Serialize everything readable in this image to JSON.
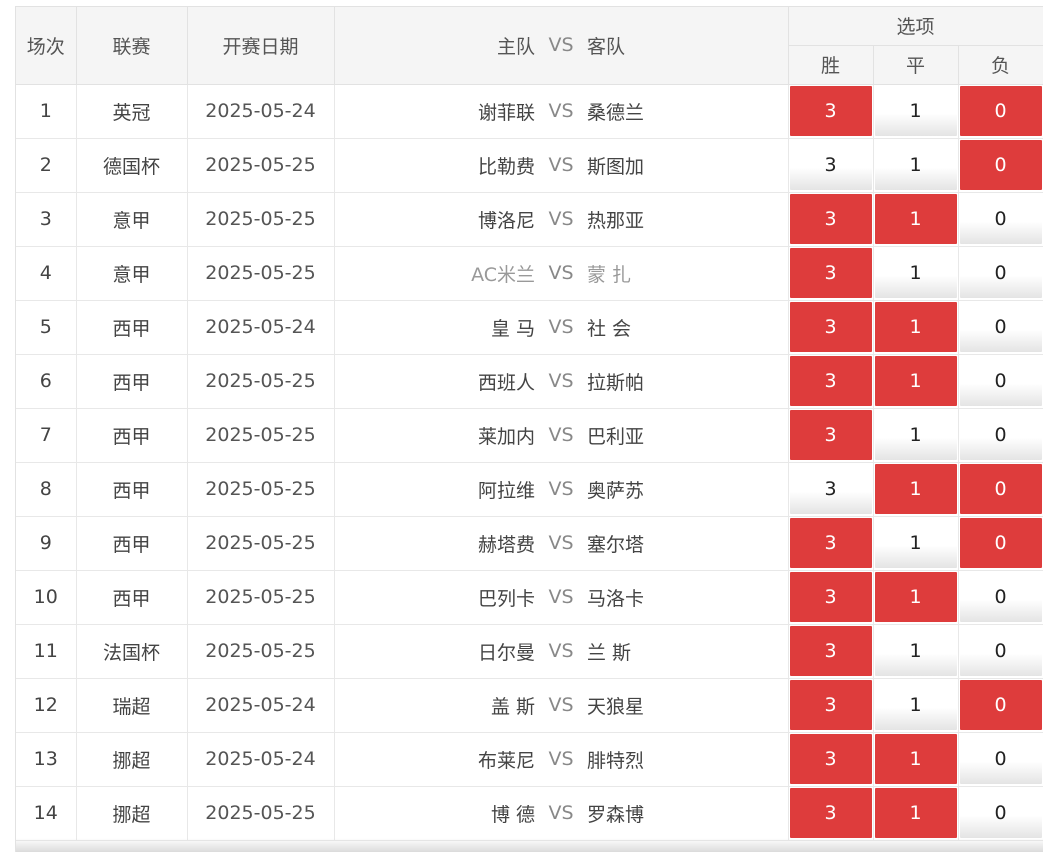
{
  "header": {
    "no": "场次",
    "league": "联赛",
    "date": "开赛日期",
    "home": "主队",
    "vs": "VS",
    "away": "客队",
    "options": "选项",
    "win": "胜",
    "draw": "平",
    "loss": "负"
  },
  "colors": {
    "selected": "#de3c3c",
    "unselected": "#f2f2f2"
  },
  "rows": [
    {
      "no": "1",
      "league": "英冠",
      "date": "2025-05-24",
      "home": "谢菲联",
      "vs": "VS",
      "away": "桑德兰",
      "win": "3",
      "draw": "1",
      "loss": "0",
      "sel": {
        "win": true,
        "draw": false,
        "loss": true
      }
    },
    {
      "no": "2",
      "league": "德国杯",
      "date": "2025-05-25",
      "home": "比勒费",
      "vs": "VS",
      "away": "斯图加",
      "win": "3",
      "draw": "1",
      "loss": "0",
      "sel": {
        "win": false,
        "draw": false,
        "loss": true
      }
    },
    {
      "no": "3",
      "league": "意甲",
      "date": "2025-05-25",
      "home": "博洛尼",
      "vs": "VS",
      "away": "热那亚",
      "win": "3",
      "draw": "1",
      "loss": "0",
      "sel": {
        "win": true,
        "draw": true,
        "loss": false
      }
    },
    {
      "no": "4",
      "league": "意甲",
      "date": "2025-05-25",
      "home": "AC米兰",
      "vs": "VS",
      "away": "蒙 扎",
      "win": "3",
      "draw": "1",
      "loss": "0",
      "sel": {
        "win": true,
        "draw": false,
        "loss": false
      },
      "muted": true
    },
    {
      "no": "5",
      "league": "西甲",
      "date": "2025-05-24",
      "home": "皇 马",
      "vs": "VS",
      "away": "社 会",
      "win": "3",
      "draw": "1",
      "loss": "0",
      "sel": {
        "win": true,
        "draw": true,
        "loss": false
      }
    },
    {
      "no": "6",
      "league": "西甲",
      "date": "2025-05-25",
      "home": "西班人",
      "vs": "VS",
      "away": "拉斯帕",
      "win": "3",
      "draw": "1",
      "loss": "0",
      "sel": {
        "win": true,
        "draw": true,
        "loss": false
      }
    },
    {
      "no": "7",
      "league": "西甲",
      "date": "2025-05-25",
      "home": "莱加内",
      "vs": "VS",
      "away": "巴利亚",
      "win": "3",
      "draw": "1",
      "loss": "0",
      "sel": {
        "win": true,
        "draw": false,
        "loss": false
      }
    },
    {
      "no": "8",
      "league": "西甲",
      "date": "2025-05-25",
      "home": "阿拉维",
      "vs": "VS",
      "away": "奥萨苏",
      "win": "3",
      "draw": "1",
      "loss": "0",
      "sel": {
        "win": false,
        "draw": true,
        "loss": true
      }
    },
    {
      "no": "9",
      "league": "西甲",
      "date": "2025-05-25",
      "home": "赫塔费",
      "vs": "VS",
      "away": "塞尔塔",
      "win": "3",
      "draw": "1",
      "loss": "0",
      "sel": {
        "win": true,
        "draw": false,
        "loss": true
      }
    },
    {
      "no": "10",
      "league": "西甲",
      "date": "2025-05-25",
      "home": "巴列卡",
      "vs": "VS",
      "away": "马洛卡",
      "win": "3",
      "draw": "1",
      "loss": "0",
      "sel": {
        "win": true,
        "draw": true,
        "loss": false
      }
    },
    {
      "no": "11",
      "league": "法国杯",
      "date": "2025-05-25",
      "home": "日尔曼",
      "vs": "VS",
      "away": "兰 斯",
      "win": "3",
      "draw": "1",
      "loss": "0",
      "sel": {
        "win": true,
        "draw": false,
        "loss": false
      }
    },
    {
      "no": "12",
      "league": "瑞超",
      "date": "2025-05-24",
      "home": "盖 斯",
      "vs": "VS",
      "away": "天狼星",
      "win": "3",
      "draw": "1",
      "loss": "0",
      "sel": {
        "win": true,
        "draw": false,
        "loss": true
      }
    },
    {
      "no": "13",
      "league": "挪超",
      "date": "2025-05-24",
      "home": "布莱尼",
      "vs": "VS",
      "away": "腓特烈",
      "win": "3",
      "draw": "1",
      "loss": "0",
      "sel": {
        "win": true,
        "draw": true,
        "loss": false
      }
    },
    {
      "no": "14",
      "league": "挪超",
      "date": "2025-05-25",
      "home": "博 德",
      "vs": "VS",
      "away": "罗森博",
      "win": "3",
      "draw": "1",
      "loss": "0",
      "sel": {
        "win": true,
        "draw": true,
        "loss": false
      }
    }
  ]
}
